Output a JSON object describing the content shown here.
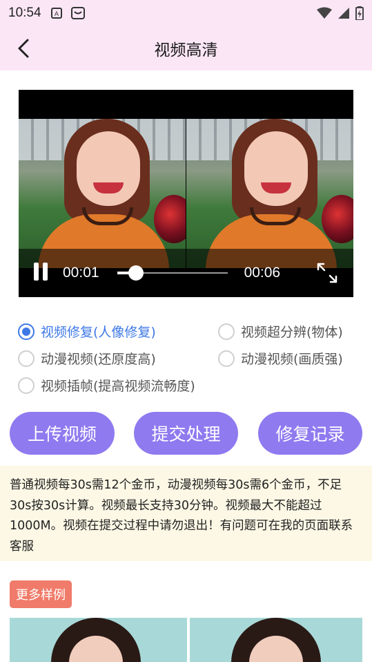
{
  "status_bar": {
    "time": "10:54",
    "left_icons": [
      "a-icon",
      "android-icon"
    ],
    "right_icons": [
      "wifi-icon",
      "signal-icon",
      "battery-icon"
    ]
  },
  "header": {
    "title": "视频高清",
    "back_icon": "chevron-left-icon"
  },
  "player": {
    "current_time": "00:01",
    "duration": "00:06",
    "progress": 0.17,
    "state": "playing",
    "pause_icon": "pause-icon",
    "fullscreen_icon": "fullscreen-icon"
  },
  "options": [
    {
      "label": "视频修复(人像修复)",
      "selected": true
    },
    {
      "label": "视频超分辨(物体)",
      "selected": false
    },
    {
      "label": "动漫视频(还原度高)",
      "selected": false
    },
    {
      "label": "动漫视频(画质强)",
      "selected": false
    },
    {
      "label": "视频插帧(提高视频流畅度)",
      "selected": false
    }
  ],
  "buttons": {
    "upload": "上传视频",
    "submit": "提交处理",
    "history": "修复记录"
  },
  "notice": "普通视频每30s需12个金币，动漫视频每30s需6个金币，不足30s按30s计算。视频最长支持30分钟。视频最大不能超过1000M。视频在提交过程中请勿退出！有问题可在我的页面联系客服",
  "samples": {
    "more_label": "更多样例"
  },
  "colors": {
    "header_bg": "#fbe6f6",
    "accent_purple": "#8f7af0",
    "radio_selected": "#3d78e6",
    "notice_bg": "#fdf8e6",
    "badge": "#f07b6a"
  }
}
